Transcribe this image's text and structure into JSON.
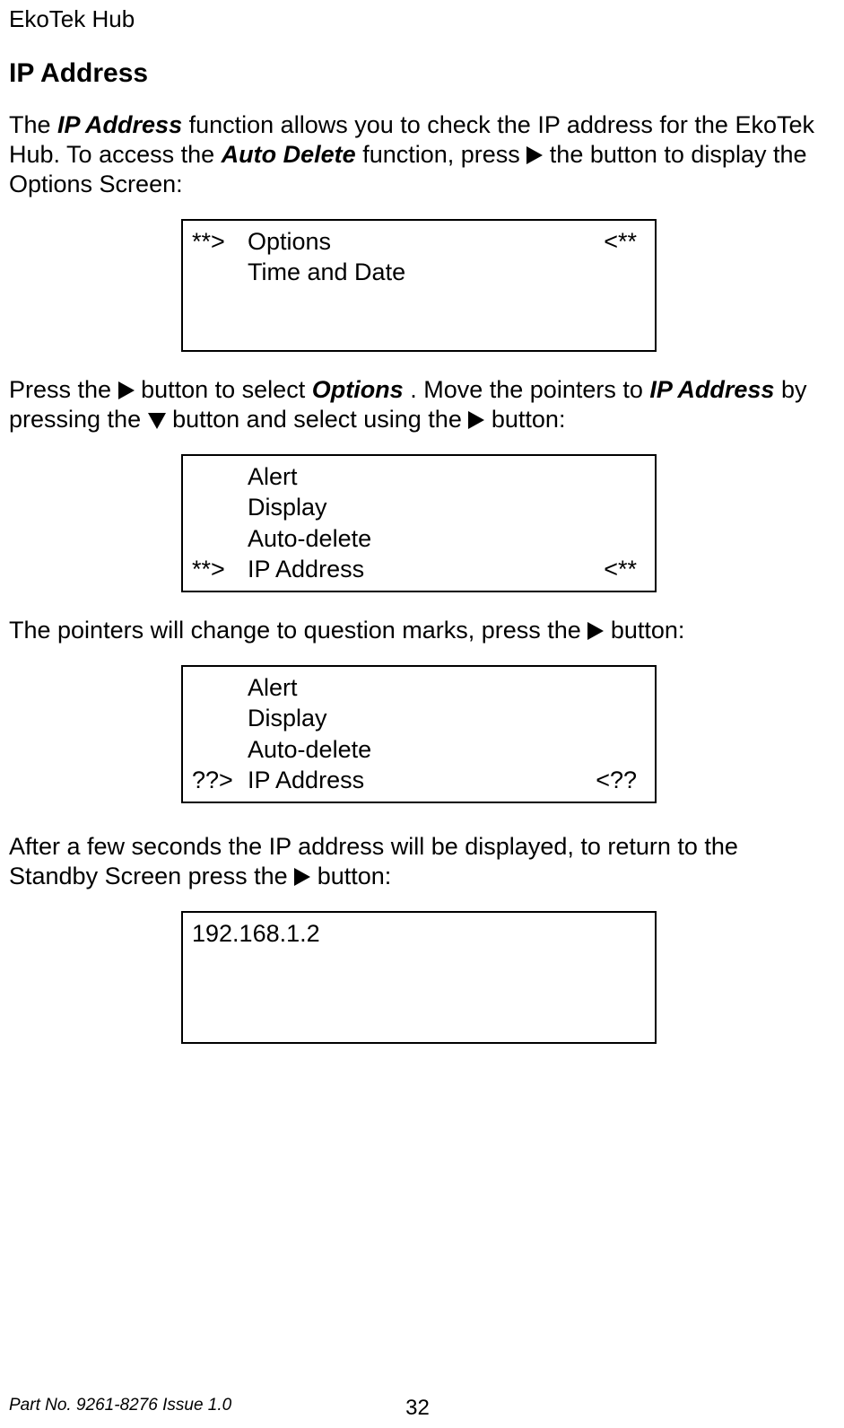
{
  "header": {
    "title": "EkoTek Hub"
  },
  "section": {
    "heading": "IP Address"
  },
  "para1": {
    "t1": "The ",
    "b1": "IP Address",
    "t2": " function allows you to check the IP address for the EkoTek Hub.  To access the ",
    "b2": "Auto Delete",
    "t3": " function, press ",
    "t4": " the button to display the Options Screen:"
  },
  "screen1": {
    "rows": [
      {
        "l": "**>",
        "c": "Options",
        "r": "<**"
      },
      {
        "l": "",
        "c": "Time and Date",
        "r": ""
      }
    ]
  },
  "para2": {
    "t1": "Press the ",
    "t2": " button to select ",
    "b1": "Options",
    "t3": ".  Move the pointers to ",
    "b2": "IP Address",
    "t4": " by pressing the ",
    "t5": " button and select using the ",
    "t6": " button:"
  },
  "screen2": {
    "rows": [
      {
        "l": "",
        "c": "Alert",
        "r": ""
      },
      {
        "l": "",
        "c": "Display",
        "r": ""
      },
      {
        "l": "",
        "c": "Auto-delete",
        "r": ""
      },
      {
        "l": "**>",
        "c": "IP Address",
        "r": "<**"
      }
    ]
  },
  "para3": {
    "t1": "The pointers will change to question marks, press the ",
    "t2": " button:"
  },
  "screen3": {
    "rows": [
      {
        "l": "",
        "c": "Alert",
        "r": ""
      },
      {
        "l": "",
        "c": "Display",
        "r": ""
      },
      {
        "l": "",
        "c": "Auto-delete",
        "r": ""
      },
      {
        "l": "??>",
        "c": "IP Address",
        "r": "<??"
      }
    ]
  },
  "para4": {
    "t1": "After a few seconds the IP address will be displayed, to return to the Standby Screen press the ",
    "t2": " button:"
  },
  "screen4": {
    "rows": [
      {
        "l": "192.168.1.2",
        "c": "",
        "r": ""
      }
    ]
  },
  "footer": {
    "part": "Part No. 9261-8276  Issue 1.0",
    "page": "32"
  }
}
